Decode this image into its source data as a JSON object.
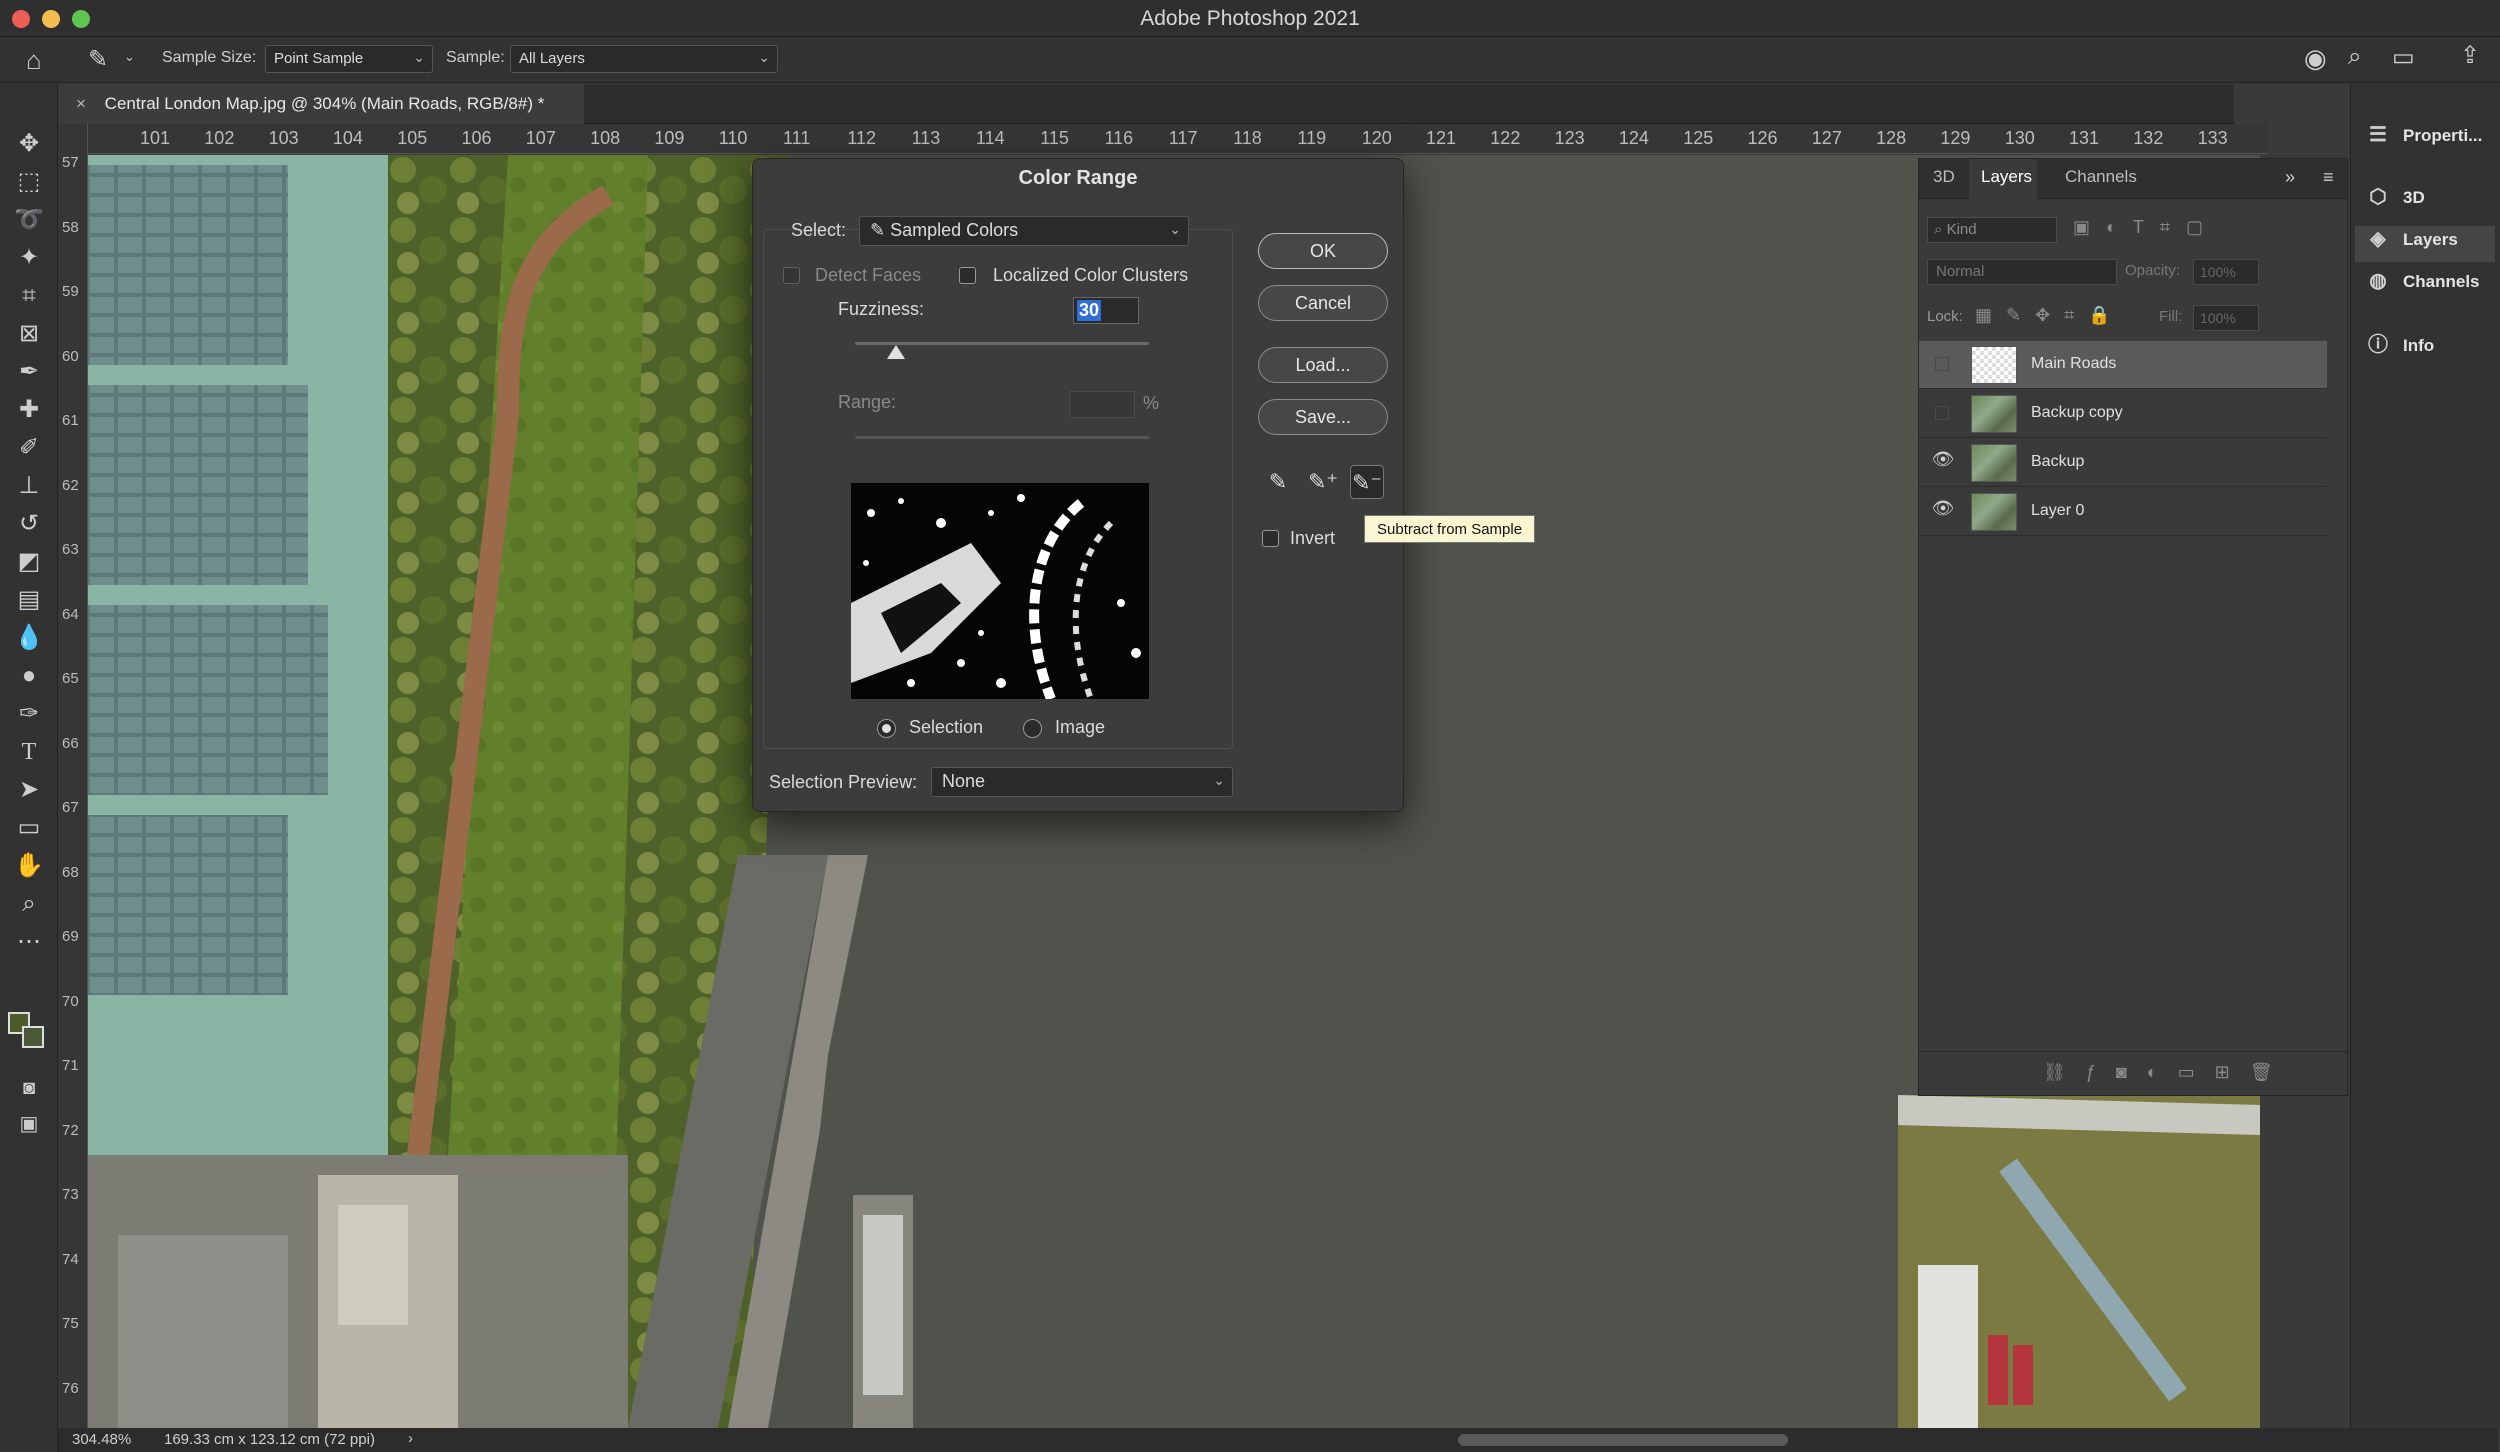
{
  "app": {
    "title": "Adobe Photoshop 2021"
  },
  "options_bar": {
    "sample_size_label": "Sample Size:",
    "sample_size_value": "Point Sample",
    "sample_label": "Sample:",
    "sample_value": "All Layers"
  },
  "document": {
    "tab_close": "×",
    "tab_title": "Central London Map.jpg @ 304% (Main Roads, RGB/8#) *"
  },
  "rulers": {
    "horizontal": [
      "101",
      "102",
      "103",
      "104",
      "105",
      "106",
      "107",
      "108",
      "109",
      "110",
      "111",
      "112",
      "113",
      "114",
      "115",
      "116",
      "117",
      "118",
      "119",
      "120",
      "121",
      "122",
      "123",
      "124",
      "125",
      "126",
      "127",
      "128",
      "129",
      "130",
      "131",
      "132",
      "133"
    ],
    "vertical": [
      "57",
      "58",
      "59",
      "60",
      "61",
      "62",
      "63",
      "64",
      "65",
      "66",
      "67",
      "68",
      "69",
      "70",
      "71",
      "72",
      "73",
      "74",
      "75",
      "76"
    ]
  },
  "dialog": {
    "title": "Color Range",
    "select_label": "Select:",
    "select_value": "Sampled Colors",
    "detect_faces": "Detect Faces",
    "localized_clusters": "Localized Color Clusters",
    "fuzziness_label": "Fuzziness:",
    "fuzziness_value": "30",
    "range_label": "Range:",
    "range_unit": "%",
    "selection_label": "Selection",
    "image_label": "Image",
    "selection_preview_label": "Selection Preview:",
    "selection_preview_value": "None",
    "ok": "OK",
    "cancel": "Cancel",
    "load": "Load...",
    "save": "Save...",
    "invert": "Invert",
    "fuzziness_level": 0.14,
    "tooltip": "Subtract from Sample"
  },
  "layers_panel": {
    "tabs": [
      "3D",
      "Layers",
      "Channels"
    ],
    "kind_placeholder": "Kind",
    "blend_mode": "Normal",
    "opacity_label": "Opacity:",
    "opacity_value": "100%",
    "lock_label": "Lock:",
    "fill_label": "Fill:",
    "fill_value": "100%",
    "layers": [
      {
        "name": "Main Roads",
        "visible": false,
        "selected": true
      },
      {
        "name": "Backup copy",
        "visible": false,
        "selected": false
      },
      {
        "name": "Backup",
        "visible": true,
        "selected": false
      },
      {
        "name": "Layer 0",
        "visible": true,
        "selected": false
      }
    ]
  },
  "right_panel": {
    "items": [
      "Properti...",
      "3D",
      "Layers",
      "Channels",
      "Info"
    ]
  },
  "status": {
    "zoom": "304.48%",
    "doc_size": "169.33 cm x 123.12 cm (72 ppi)",
    "arrow": "›"
  },
  "colors": {
    "accent": "#2f6ed6",
    "tooltip_bg": "#fbf6d2",
    "close": "#ec5f57",
    "minimize": "#f4be4f",
    "maximize": "#5fc454"
  }
}
